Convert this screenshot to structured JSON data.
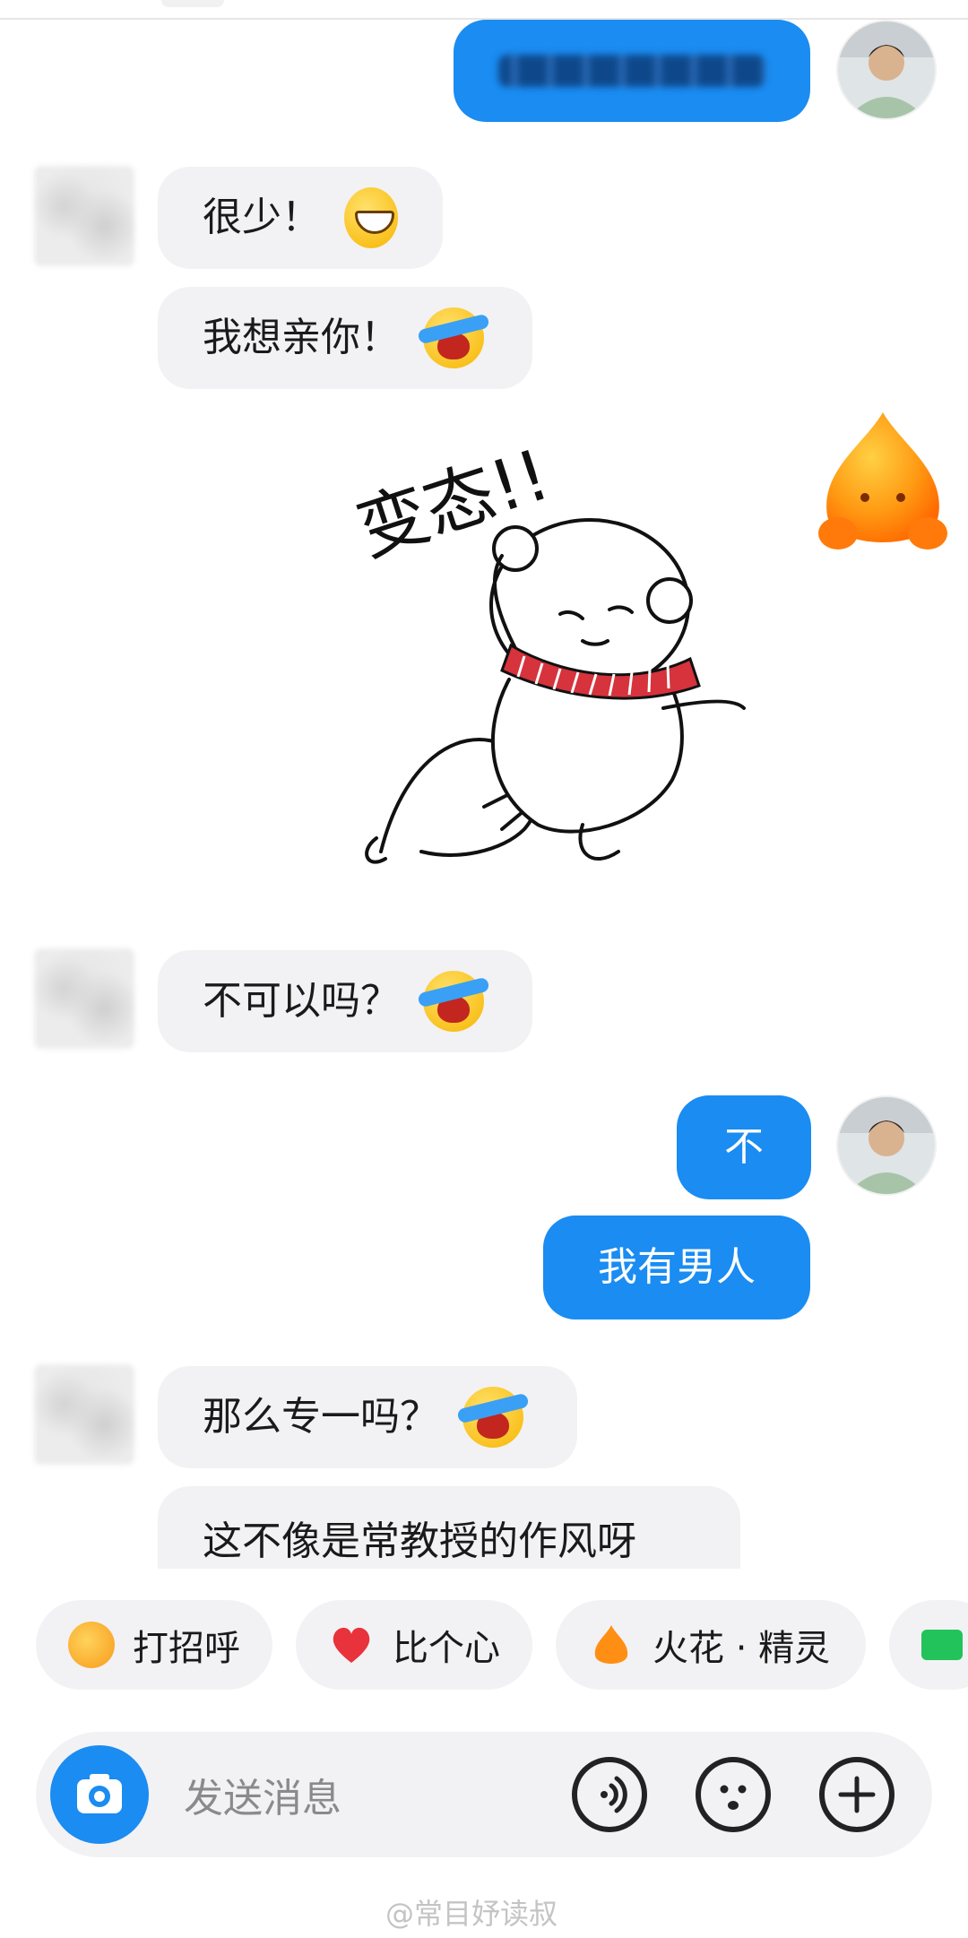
{
  "messages": [
    {
      "side": "out",
      "text": "",
      "blurred": true
    },
    {
      "side": "in",
      "text": "很少！",
      "emoji": "grinning-face-emoji"
    },
    {
      "side": "in",
      "text": "我想亲你！",
      "emoji": "loudly-crying-face-emoji"
    },
    {
      "side": "in",
      "sticker_text": "变态!!"
    },
    {
      "side": "in",
      "text": "不可以吗？",
      "emoji": "loudly-crying-face-emoji"
    },
    {
      "side": "out",
      "text": "不"
    },
    {
      "side": "out",
      "text": "我有男人"
    },
    {
      "side": "in",
      "text": "那么专一吗？",
      "emoji": "loudly-crying-face-emoji"
    },
    {
      "side": "in",
      "text": "这不像是常教授的作风呀"
    }
  ],
  "quick_replies": [
    {
      "label": "打招呼",
      "icon": "wave-hand-icon"
    },
    {
      "label": "比个心",
      "icon": "heart-icon"
    },
    {
      "label": "火花 · 精灵",
      "icon": "spark-sprite-icon"
    }
  ],
  "composer": {
    "placeholder": "发送消息"
  },
  "watermark": "@常目妤读叔",
  "colors": {
    "accent": "#1a8cf2",
    "bubble_in": "#f2f2f4"
  }
}
